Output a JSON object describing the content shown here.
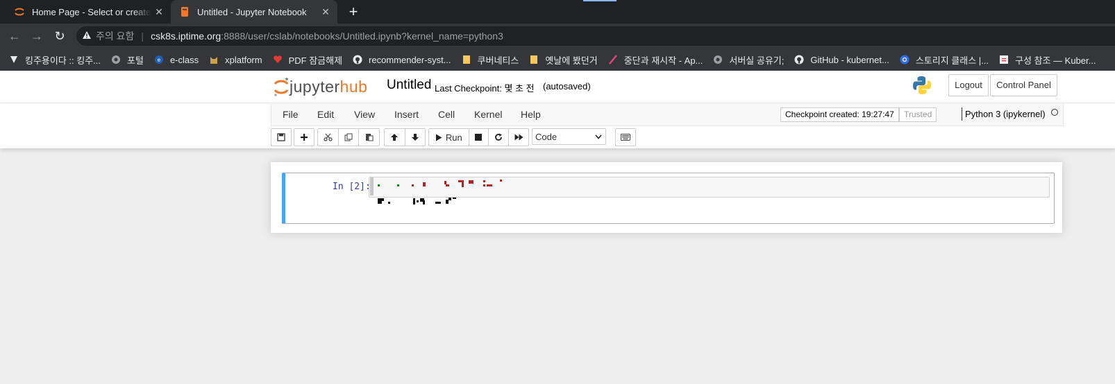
{
  "browser": {
    "tabs": [
      {
        "title": "Home Page - Select or create a",
        "active": false,
        "icon": "jupyter-icon"
      },
      {
        "title": "Untitled - Jupyter Notebook",
        "active": true,
        "icon": "notebook-icon"
      }
    ],
    "close_glyph": "✕",
    "new_tab_glyph": "+",
    "nav": {
      "back": "←",
      "forward": "→",
      "reload": "↻"
    },
    "address": {
      "warning_label": "주의 요함",
      "separator": "|",
      "host": "csk8s.iptime.org",
      "rest": ":8888/user/cslab/notebooks/Untitled.ipynb?kernel_name=python3"
    },
    "bookmarks": [
      {
        "label": "킹주용이다 :: 킹주...",
        "icon": "speed-icon"
      },
      {
        "label": "포털",
        "icon": "globe-icon"
      },
      {
        "label": "e-class",
        "icon": "eclass-icon"
      },
      {
        "label": "xplatform",
        "icon": "cat-icon"
      },
      {
        "label": "PDF 잠금해제",
        "icon": "heart-icon"
      },
      {
        "label": "recommender-syst...",
        "icon": "github-icon"
      },
      {
        "label": "쿠버네티스",
        "icon": "folder-icon"
      },
      {
        "label": "옛날에 봤던거",
        "icon": "folder-icon"
      },
      {
        "label": "중단과 재시작 - Ap...",
        "icon": "feather-icon"
      },
      {
        "label": "서버실 공유기;",
        "icon": "globe-icon"
      },
      {
        "label": "GitHub - kubernet...",
        "icon": "github-icon"
      },
      {
        "label": "스토리지 클래스 |...",
        "icon": "kubernetes-icon"
      },
      {
        "label": "구성 참조 — Kuber...",
        "icon": "doc-icon"
      }
    ]
  },
  "jupyter": {
    "logo_left": "jupyter",
    "logo_right": "hub",
    "notebook_name": "Untitled",
    "checkpoint_label": "Last Checkpoint: 몇 초 전",
    "autosave": "(autosaved)",
    "logout": "Logout",
    "control_panel": "Control Panel",
    "menus": [
      "File",
      "Edit",
      "View",
      "Insert",
      "Cell",
      "Kernel",
      "Help"
    ],
    "checkpoint_created": "Checkpoint created: 19:27:47",
    "trusted": "Trusted",
    "kernel": "Python 3 (ipykernel)",
    "toolbar": {
      "run_label": "Run",
      "cell_type": "Code"
    },
    "cell": {
      "prompt": "In [2]:"
    },
    "colors": {
      "accent_orange": "#f37726",
      "cell_border": "#42a5f5",
      "prompt": "#303f9f"
    }
  }
}
